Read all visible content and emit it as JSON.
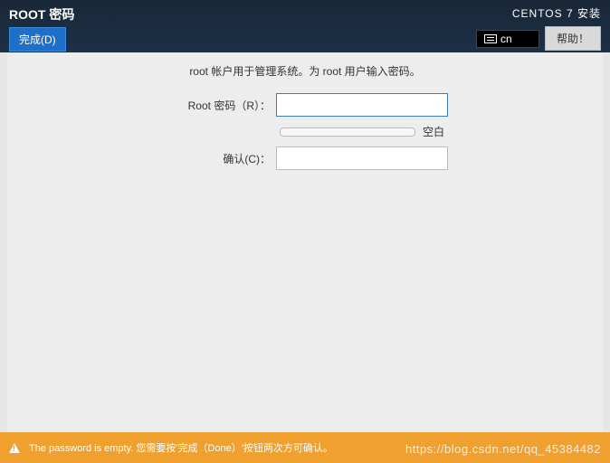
{
  "header": {
    "title": "ROOT 密码",
    "done_label": "完成(D)",
    "installer_title": "CENTOS 7 安装",
    "lang_code": "cn",
    "help_label": "帮助！"
  },
  "instruction": "root 帐户用于管理系统。为 root 用户输入密码。",
  "form": {
    "password_label": "Root 密码（R）：",
    "password_value": "",
    "confirm_label": "确认(C)：",
    "confirm_value": "",
    "strength_label": "空白"
  },
  "warning": {
    "text": "The password is empty. 您需要按'完成（Done）'按钮两次方可确认。"
  },
  "watermark": "https://blog.csdn.net/qq_45384482"
}
